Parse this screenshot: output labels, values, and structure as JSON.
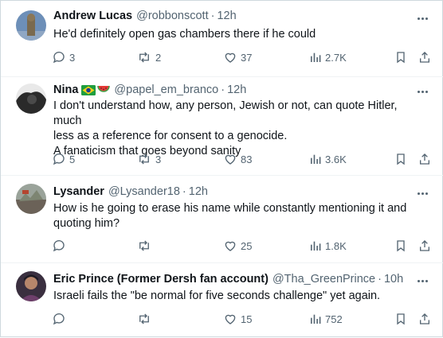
{
  "tweets": [
    {
      "name": "Andrew Lucas",
      "handle": "@robbonscott",
      "time": "12h",
      "text": [
        "He'd definitely open gas chambers there  if he could"
      ],
      "replies": "3",
      "retweets": "2",
      "likes": "37",
      "views": "2.7K"
    },
    {
      "name": "Nina",
      "flags": [
        "brazil-flag-icon",
        "watermelon-icon"
      ],
      "handle": "@papel_em_branco",
      "time": "12h",
      "text": [
        "I don't understand how, any person, Jewish or not, can quote Hitler, much",
        "less as a reference for consent to a genocide.",
        "A fanaticism that goes beyond sanity"
      ],
      "replies": "5",
      "retweets": "3",
      "likes": "83",
      "views": "3.6K"
    },
    {
      "name": "Lysander",
      "handle": "@Lysander18",
      "time": "12h",
      "text": [
        "How is he going to erase his name while constantly mentioning it and",
        "quoting him?"
      ],
      "replies": "",
      "retweets": "",
      "likes": "25",
      "views": "1.8K"
    },
    {
      "name": "Eric Prince (Former Dersh fan account)",
      "handle": "@Tha_GreenPrince",
      "time": "10h",
      "text": [
        "Israeli fails the  \"be normal for five seconds challenge\" yet again."
      ],
      "replies": "",
      "retweets": "",
      "likes": "15",
      "views": "752"
    }
  ],
  "separator": "·",
  "colors": {
    "text": "#0f1419",
    "secondary": "#536471",
    "divider": "#eff3f4"
  }
}
